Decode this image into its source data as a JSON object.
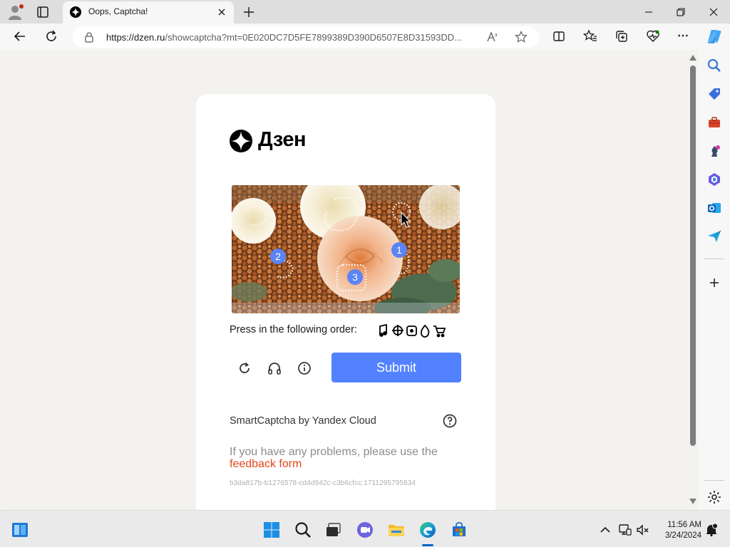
{
  "browser": {
    "tab_title": "Oops, Captcha!",
    "url_host": "https://dzen.ru",
    "url_path": "/showcaptcha?mt=0E020DC7D5FE7899389D390D6507E8D31593DD..."
  },
  "captcha": {
    "brand": "Дзен",
    "order_label": "Press in the following order:",
    "order_icons": [
      "music-note-icon",
      "crossed-circle-icon",
      "square-dot-icon",
      "drop-icon",
      "cart-icon"
    ],
    "markers": [
      "1",
      "2",
      "3"
    ],
    "submit_label": "Submit",
    "provider": "SmartCaptcha by Yandex Cloud",
    "problems_text": "If you have any problems, please use the",
    "feedback_link": "feedback form",
    "request_id": "b3da817b-b1276578-cd4d942c-c3b6cfcc:1711295795834"
  },
  "taskbar": {
    "time": "11:56 AM",
    "date": "3/24/2024"
  },
  "colors": {
    "accent": "#5282ff",
    "link": "#e2471a",
    "marker": "#5b84f5"
  }
}
